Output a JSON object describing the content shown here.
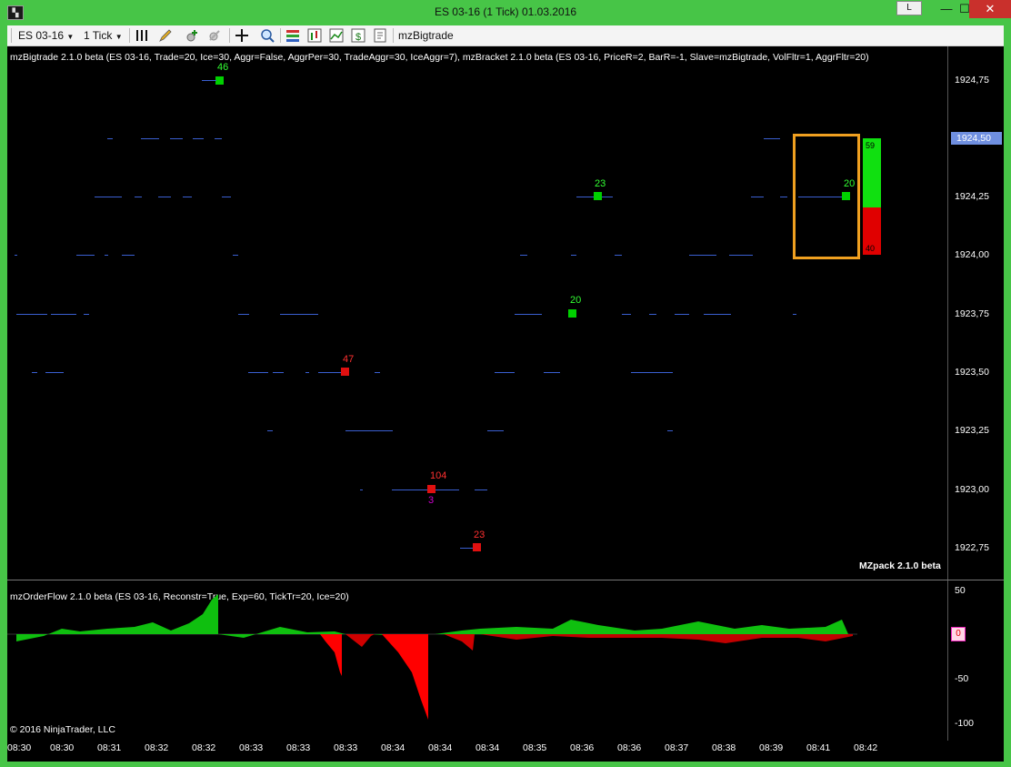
{
  "window": {
    "title": "ES 03-16 (1 Tick)  01.03.2016",
    "btn_l": "L",
    "btn_min": "—",
    "btn_max": "☐",
    "btn_close": "✕"
  },
  "toolbar": {
    "instrument": "ES 03-16",
    "interval": "1 Tick",
    "indicator": "mzBigtrade"
  },
  "chart": {
    "indicator_header": "mzBigtrade 2.1.0 beta (ES 03-16, Trade=20, Ice=30, Aggr=False, AggrPer=30, TradeAggr=30, IceAggr=7), mzBracket 2.1.0 beta (ES 03-16, PriceR=2, BarR=-1, Slave=mzBigtrade, VolFltr=1, AggrFltr=20)",
    "brand_label": "MZpack 2.1.0 beta",
    "current_price": "1924,50",
    "price_labels": [
      "1924,75",
      "1924,50",
      "1924,25",
      "1924,00",
      "1923,75",
      "1923,50",
      "1923,25",
      "1923,00",
      "1922,75"
    ],
    "trade_labels": {
      "t46": "46",
      "t23a": "23",
      "t20a": "20",
      "t20b": "20",
      "t47": "47",
      "t104": "104",
      "t3": "3",
      "t23b": "23"
    },
    "bracket": {
      "upper": "59",
      "lower": "40"
    }
  },
  "orderflow": {
    "header": "mzOrderFlow 2.1.0 beta (ES 03-16, Reconstr=True, Exp=60, TickTr=20, Ice=20)",
    "axis_labels": [
      "50",
      "0",
      "-50",
      "-100"
    ],
    "zero_tag": "0",
    "copyright": "© 2016 NinjaTrader, LLC"
  },
  "time_axis": [
    "08:30",
    "08:30",
    "08:31",
    "08:32",
    "08:32",
    "08:33",
    "08:33",
    "08:33",
    "08:34",
    "08:34",
    "08:34",
    "08:35",
    "08:36",
    "08:36",
    "08:37",
    "08:38",
    "08:39",
    "08:41",
    "08:42"
  ],
  "colors": {
    "buy": "#00d000",
    "sell": "#e01010",
    "bracket_box": "#f0a020",
    "price_marker": "#6f8fe0"
  }
}
